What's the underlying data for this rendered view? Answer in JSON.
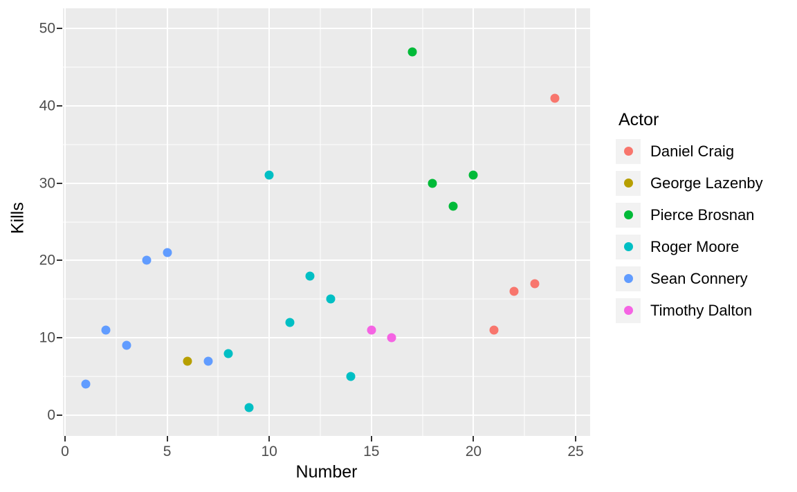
{
  "chart_data": {
    "type": "scatter",
    "title": "",
    "xlabel": "Number",
    "ylabel": "Kills",
    "xlim": [
      0,
      25
    ],
    "ylim": [
      0,
      50
    ],
    "x_ticks": [
      0,
      5,
      10,
      15,
      20,
      25
    ],
    "y_ticks": [
      0,
      10,
      20,
      30,
      40,
      50
    ],
    "x_minor_ticks": [
      2.5,
      7.5,
      12.5,
      17.5,
      22.5
    ],
    "y_minor_ticks": [
      5,
      15,
      25,
      35,
      45
    ],
    "grid": true,
    "legend_position": "right",
    "legend_title": "Actor",
    "panel_background": "#ebebeb",
    "grid_color": "#ffffff",
    "series": [
      {
        "name": "Daniel Craig",
        "color": "#F8766D",
        "points": [
          {
            "x": 21,
            "y": 11
          },
          {
            "x": 22,
            "y": 16
          },
          {
            "x": 23,
            "y": 17
          },
          {
            "x": 24,
            "y": 41
          }
        ]
      },
      {
        "name": "George Lazenby",
        "color": "#B79F00",
        "points": [
          {
            "x": 6,
            "y": 7
          }
        ]
      },
      {
        "name": "Pierce Brosnan",
        "color": "#00BA38",
        "points": [
          {
            "x": 17,
            "y": 47
          },
          {
            "x": 18,
            "y": 30
          },
          {
            "x": 19,
            "y": 27
          },
          {
            "x": 20,
            "y": 31
          }
        ]
      },
      {
        "name": "Roger Moore",
        "color": "#00BFC4",
        "points": [
          {
            "x": 8,
            "y": 8
          },
          {
            "x": 9,
            "y": 1
          },
          {
            "x": 10,
            "y": 31
          },
          {
            "x": 11,
            "y": 12
          },
          {
            "x": 12,
            "y": 18
          },
          {
            "x": 13,
            "y": 15
          },
          {
            "x": 14,
            "y": 5
          }
        ]
      },
      {
        "name": "Sean Connery",
        "color": "#619CFF",
        "points": [
          {
            "x": 1,
            "y": 4
          },
          {
            "x": 2,
            "y": 11
          },
          {
            "x": 3,
            "y": 9
          },
          {
            "x": 4,
            "y": 20
          },
          {
            "x": 5,
            "y": 21
          },
          {
            "x": 7,
            "y": 7
          }
        ]
      },
      {
        "name": "Timothy Dalton",
        "color": "#F564E3",
        "points": [
          {
            "x": 15,
            "y": 11
          },
          {
            "x": 16,
            "y": 10
          }
        ]
      }
    ]
  },
  "axes": {
    "x_title": "Number",
    "y_title": "Kills",
    "x_tick_labels": [
      "0",
      "5",
      "10",
      "15",
      "20",
      "25"
    ],
    "y_tick_labels": [
      "0",
      "10",
      "20",
      "30",
      "40",
      "50"
    ]
  },
  "legend": {
    "title": "Actor",
    "items": [
      {
        "label": "Daniel Craig",
        "color": "#F8766D"
      },
      {
        "label": "George Lazenby",
        "color": "#B79F00"
      },
      {
        "label": "Pierce Brosnan",
        "color": "#00BA38"
      },
      {
        "label": "Roger Moore",
        "color": "#00BFC4"
      },
      {
        "label": "Sean Connery",
        "color": "#619CFF"
      },
      {
        "label": "Timothy Dalton",
        "color": "#F564E3"
      }
    ]
  }
}
